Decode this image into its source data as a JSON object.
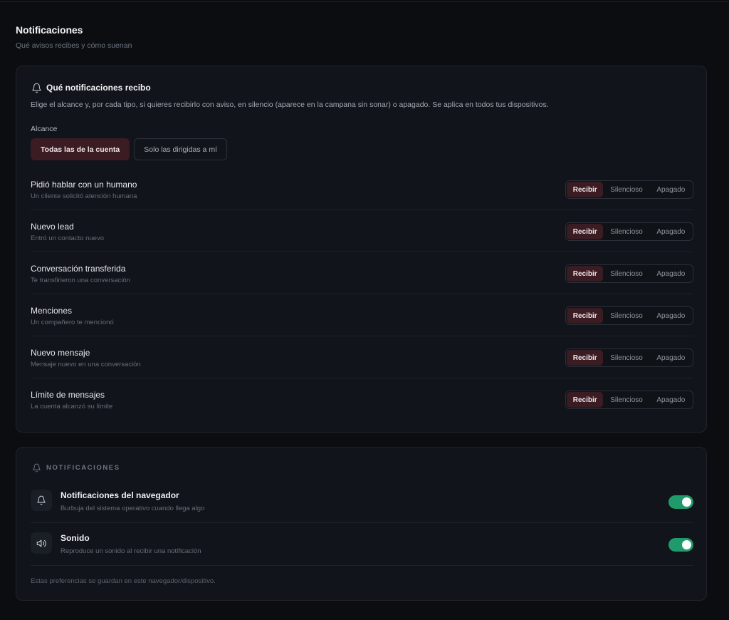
{
  "page": {
    "title": "Notificaciones",
    "subtitle": "Qué avisos recibes y cómo suenan"
  },
  "receive_card": {
    "icon": "bell-icon",
    "title": "Qué notificaciones recibo",
    "description": "Elige el alcance y, por cada tipo, si quieres recibirlo con aviso, en silencio (aparece en la campana sin sonar) o apagado. Se aplica en todos tus dispositivos.",
    "scope_label": "Alcance",
    "scope_options": [
      {
        "label": "Todas las de la cuenta",
        "selected": true
      },
      {
        "label": "Solo las dirigidas a mí",
        "selected": false
      }
    ],
    "mode_options": [
      "Recibir",
      "Silencioso",
      "Apagado"
    ],
    "types": [
      {
        "title": "Pidió hablar con un humano",
        "subtitle": "Un cliente solicitó atención humana",
        "selected": "Recibir"
      },
      {
        "title": "Nuevo lead",
        "subtitle": "Entró un contacto nuevo",
        "selected": "Recibir"
      },
      {
        "title": "Conversación transferida",
        "subtitle": "Te transfirieron una conversación",
        "selected": "Recibir"
      },
      {
        "title": "Menciones",
        "subtitle": "Un compañero te mencionó",
        "selected": "Recibir"
      },
      {
        "title": "Nuevo mensaje",
        "subtitle": "Mensaje nuevo en una conversación",
        "selected": "Recibir"
      },
      {
        "title": "Límite de mensajes",
        "subtitle": "La cuenta alcanzó su límite",
        "selected": "Recibir"
      }
    ]
  },
  "device_card": {
    "icon": "bell-icon",
    "heading": "NOTIFICACIONES",
    "prefs": [
      {
        "icon": "bell-icon",
        "title": "Notificaciones del navegador",
        "subtitle": "Burbuja del sistema operativo cuando llega algo",
        "enabled": true
      },
      {
        "icon": "speaker-icon",
        "title": "Sonido",
        "subtitle": "Reproduce un sonido al recibir una notificación",
        "enabled": true
      }
    ],
    "footnote": "Estas preferencias se guardan en este navegador/dispositivo."
  },
  "colors": {
    "background": "#0b0d11",
    "card": "#11141a",
    "accent_selected": "#3a1c22",
    "toggle_on": "#1f9a6a"
  }
}
